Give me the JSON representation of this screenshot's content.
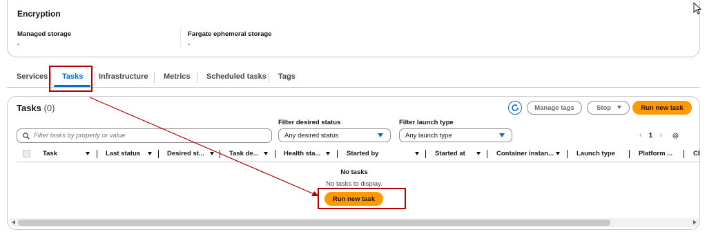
{
  "encryption": {
    "title": "Encryption",
    "managed_storage_label": "Managed storage",
    "managed_storage_value": "-",
    "fargate_storage_label": "Fargate ephemeral storage",
    "fargate_storage_value": "-"
  },
  "tabs": [
    {
      "label": "Services",
      "active": false
    },
    {
      "label": "Tasks",
      "active": true
    },
    {
      "label": "Infrastructure",
      "active": false
    },
    {
      "label": "Metrics",
      "active": false
    },
    {
      "label": "Scheduled tasks",
      "active": false
    },
    {
      "label": "Tags",
      "active": false
    }
  ],
  "tasks_panel": {
    "title": "Tasks",
    "count": "(0)",
    "manage_tags_label": "Manage tags",
    "stop_label": "Stop",
    "run_new_task_label": "Run new task",
    "filter_status_label": "Filter desired status",
    "filter_status_value": "Any desired status",
    "filter_launch_label": "Filter launch type",
    "filter_launch_value": "Any launch type",
    "search_placeholder": "Filter tasks by property or value",
    "page_number": "1",
    "columns": [
      "Task",
      "Last status",
      "Desired st...",
      "Task de...",
      "Health sta...",
      "Started by",
      "Started at",
      "Container instan...",
      "Launch type",
      "Platform ...",
      "CPU"
    ],
    "empty_title": "No tasks",
    "empty_subtitle": "No tasks to display.",
    "empty_button_label": "Run new task"
  },
  "colors": {
    "primary_button": "#ff9900",
    "active_tab": "#006ce0",
    "annotation": "#b30000"
  }
}
